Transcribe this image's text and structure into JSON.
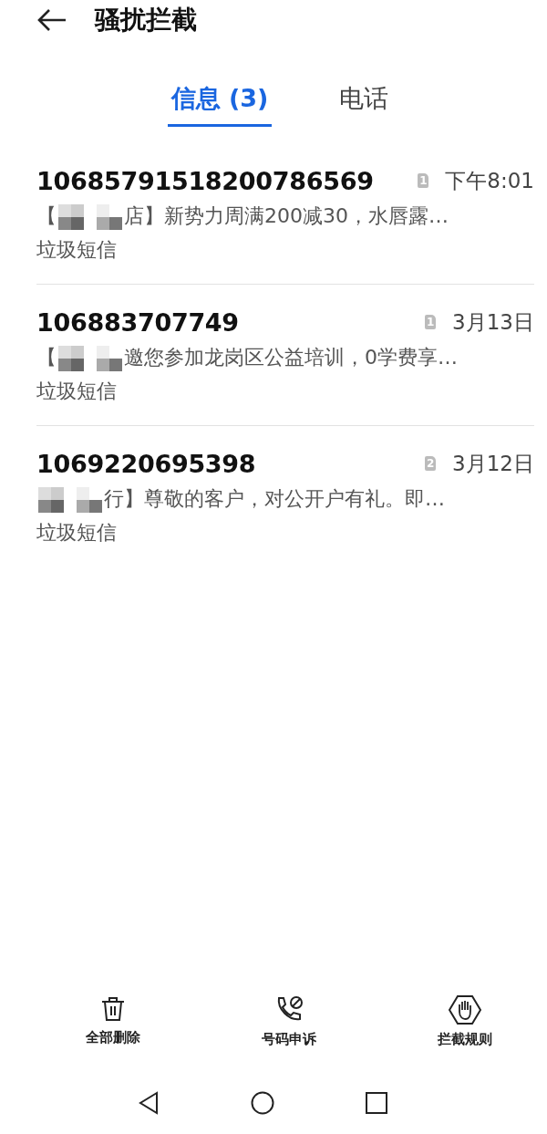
{
  "header": {
    "title": "骚扰拦截"
  },
  "tabs": [
    {
      "label": "信息 (3)",
      "selected": true
    },
    {
      "label": "电话",
      "selected": false
    }
  ],
  "messages": [
    {
      "sender": "10685791518200786569",
      "sim": "1",
      "time": "下午8:01",
      "preview_before": "【",
      "preview": "店】新势力周满200减30，水唇露…",
      "category": "垃圾短信"
    },
    {
      "sender": "106883707749",
      "sim": "1",
      "time": "3月13日",
      "preview_before": "【",
      "preview": "邀您参加龙岗区公益培训，0学费享…",
      "category": "垃圾短信"
    },
    {
      "sender": "1069220695398",
      "sim": "2",
      "time": "3月12日",
      "preview": "行】尊敬的客户，对公开户有礼。即…",
      "category": "垃圾短信"
    }
  ],
  "actions": [
    {
      "kind": "delete",
      "label": "全部删除"
    },
    {
      "kind": "appeal",
      "label": "号码申诉"
    },
    {
      "kind": "rules",
      "label": "拦截规则"
    }
  ]
}
